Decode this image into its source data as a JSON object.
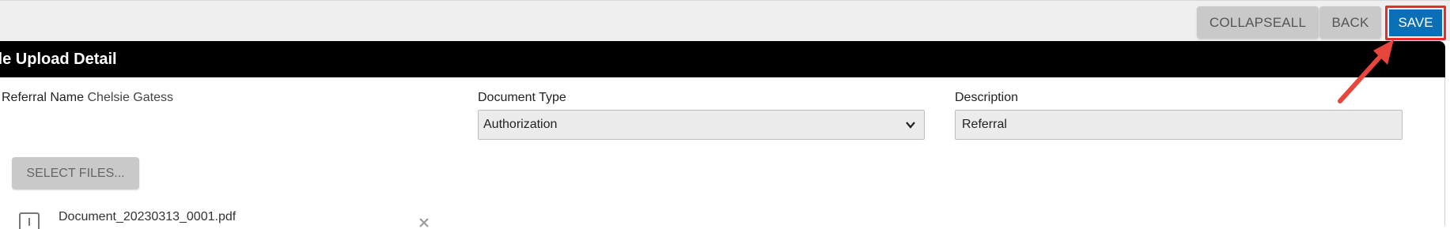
{
  "toolbar": {
    "collapse_label": "COLLAPSEALL",
    "back_label": "BACK",
    "save_label": "SAVE"
  },
  "panel": {
    "title": "File Upload Detail",
    "visible_title": "ile Upload Detail"
  },
  "form": {
    "referral_label": "Referral Name",
    "referral_value": "Chelsie Gatess",
    "document_type_label": "Document Type",
    "document_type_value": "Authorization",
    "description_label": "Description",
    "description_value": "Referral"
  },
  "files": {
    "select_label": "SELECT FILES...",
    "items": [
      {
        "name": "Document_20230313_0001.pdf"
      }
    ]
  },
  "colors": {
    "save_bg": "#0b6fb5",
    "highlight": "#e0302e",
    "header_bg": "#000000"
  }
}
